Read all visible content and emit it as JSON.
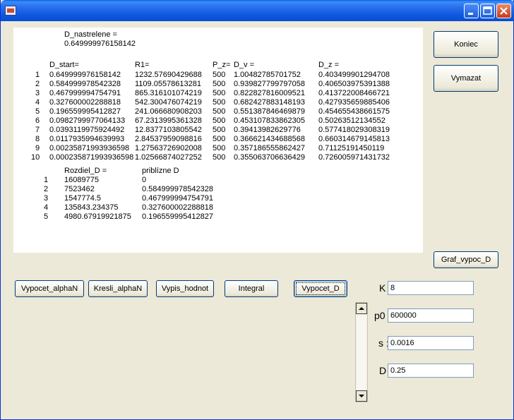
{
  "window": {
    "title": "",
    "title_icon": "app-icon"
  },
  "titlebar_buttons": {
    "minimize": "minimize-icon",
    "maximize": "maximize-icon",
    "close": "close-icon"
  },
  "output": {
    "d_nastrelene_label": "D_nastrelene =",
    "d_nastrelene_value": "0.649999976158142",
    "headers": {
      "d_start": "D_start=",
      "r1": "R1=",
      "p_z": "P_z=",
      "d_v": "D_v =",
      "d_z": "D_z ="
    },
    "rows": [
      {
        "n": "1",
        "d_start": "0.649999976158142",
        "r1": "1232.57690429688",
        "p_z": "500",
        "d_v": "1.00482785701752",
        "d_z": "0.403499901294708"
      },
      {
        "n": "2",
        "d_start": "0.584999978542328",
        "r1": "1109.05578613281",
        "p_z": "500",
        "d_v": "0.939827799797058",
        "d_z": "0.406503975391388"
      },
      {
        "n": "3",
        "d_start": "0.467999994754791",
        "r1": "865.316101074219",
        "p_z": "500",
        "d_v": "0.822827816009521",
        "d_z": "0.413722008466721"
      },
      {
        "n": "4",
        "d_start": "0.327600002288818",
        "r1": "542.300476074219",
        "p_z": "500",
        "d_v": "0.682427883148193",
        "d_z": "0.427935659885406"
      },
      {
        "n": "5",
        "d_start": "0.196559995412827",
        "r1": "241.066680908203",
        "p_z": "500",
        "d_v": "0.551387846469879",
        "d_z": "0.454655438661575"
      },
      {
        "n": "6",
        "d_start": "0.0982799977064133",
        "r1": "67.2313995361328",
        "p_z": "500",
        "d_v": "0.453107833862305",
        "d_z": "0.50263512134552"
      },
      {
        "n": "7",
        "d_start": "0.0393119975924492",
        "r1": "12.8377103805542",
        "p_z": "500",
        "d_v": "0.39413982629776",
        "d_z": "0.577418029308319"
      },
      {
        "n": "8",
        "d_start": "0.0117935994639993",
        "r1": "2.84537959098816",
        "p_z": "500",
        "d_v": "0.366621434688568",
        "d_z": "0.660314679145813"
      },
      {
        "n": "9",
        "d_start": "0.00235871993936598",
        "r1": "1.27563726902008",
        "p_z": "500",
        "d_v": "0.357186555862427",
        "d_z": "0.71125191450119"
      },
      {
        "n": "10",
        "d_start": "0.000235871993936598",
        "r1": "1.02566874027252",
        "p_z": "500",
        "d_v": "0.355063706636429",
        "d_z": "0.726005971431732"
      }
    ],
    "headers2": {
      "rozdiel": "Rozdiel_D =",
      "priblizne": "priblízne D"
    },
    "rows2": [
      {
        "n": "1",
        "rozdiel": "16089775",
        "priblizne": "0"
      },
      {
        "n": "2",
        "rozdiel": "7523462",
        "priblizne": "0.584999978542328"
      },
      {
        "n": "3",
        "rozdiel": "1547774.5",
        "priblizne": "0.467999994754791"
      },
      {
        "n": "4",
        "rozdiel": "135843.234375",
        "priblizne": "0.327600002288818"
      },
      {
        "n": "5",
        "rozdiel": "4980.67919921875",
        "priblizne": "0.196559995412827"
      }
    ]
  },
  "side_buttons": {
    "koniec": "Koniec",
    "vymazat": "Vymazat",
    "graf": "Graf_vypoc_D"
  },
  "bottom_buttons": {
    "vypocet_alpha": "Vypocet_alphaN",
    "kresli_alpha": "Kresli_alphaN",
    "vypis_hodnot": "Vypis_hodnot",
    "integral": "Integral",
    "vypocet_d": "Vypocet_D"
  },
  "params": {
    "k_label": "K",
    "k_value": "8",
    "p0_label": "p0",
    "p0_value": "600000",
    "s_label": "s :",
    "s_value": "0.0016",
    "d_label": "D",
    "d_value": "0.25"
  }
}
